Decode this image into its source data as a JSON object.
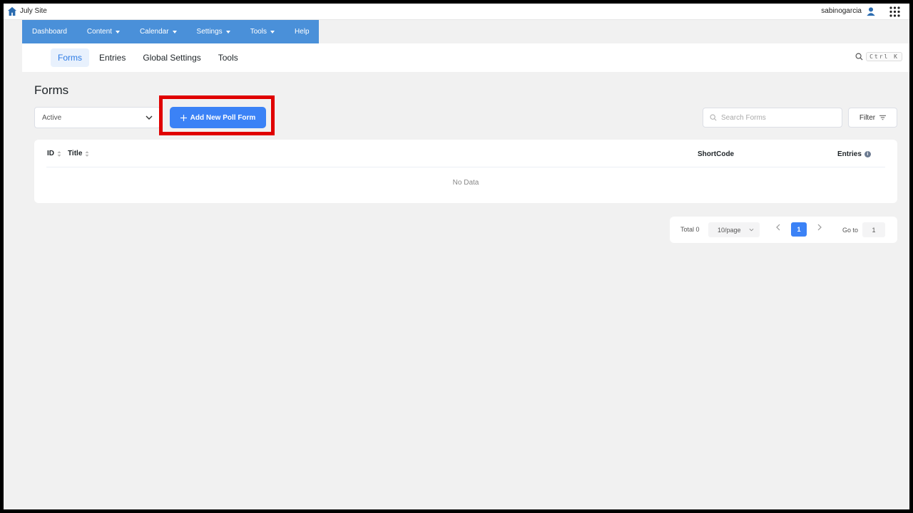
{
  "adminbar": {
    "site_name": "July Site",
    "username": "sabinogarcia",
    "icons": [
      "home-icon",
      "user-icon",
      "apps-grid-icon"
    ]
  },
  "nav": {
    "items": [
      {
        "label": "Dashboard",
        "dropdown": false
      },
      {
        "label": "Content",
        "dropdown": true
      },
      {
        "label": "Calendar",
        "dropdown": true
      },
      {
        "label": "Settings",
        "dropdown": true
      },
      {
        "label": "Tools",
        "dropdown": true
      },
      {
        "label": "Help",
        "dropdown": false
      }
    ],
    "color": "#4a90d9"
  },
  "subnav": {
    "tabs": [
      {
        "label": "Forms",
        "active": true
      },
      {
        "label": "Entries",
        "active": false
      },
      {
        "label": "Global Settings",
        "active": false
      },
      {
        "label": "Tools",
        "active": false
      }
    ],
    "shortcut": "Ctrl K"
  },
  "page": {
    "title": "Forms",
    "status_selected": "Active",
    "add_button_label": "Add New Poll Form",
    "search_placeholder": "Search Forms",
    "filter_label": "Filter"
  },
  "table": {
    "columns": [
      "ID",
      "Title",
      "ShortCode",
      "Entries"
    ],
    "rows": [],
    "empty_text": "No Data"
  },
  "pagination": {
    "total_label": "Total 0",
    "per_page": "10/page",
    "current_page": "1",
    "goto_label": "Go to",
    "goto_value": "1"
  },
  "colors": {
    "accent": "#3b82f6",
    "highlight": "#e00000"
  }
}
